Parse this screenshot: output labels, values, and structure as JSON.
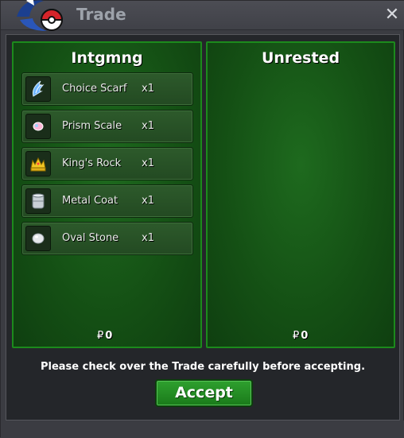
{
  "window": {
    "title": "Trade",
    "close_icon": "close-icon",
    "logo_icon": "pokeball-logo-icon"
  },
  "panels": {
    "left": {
      "player": "Intgmng",
      "money_symbol": "₽",
      "money": "0",
      "items": [
        {
          "name": "Choice Scarf",
          "qty": "x1",
          "icon": "choice-scarf-icon"
        },
        {
          "name": "Prism Scale",
          "qty": "x1",
          "icon": "prism-scale-icon"
        },
        {
          "name": "King's Rock",
          "qty": "x1",
          "icon": "kings-rock-icon"
        },
        {
          "name": "Metal Coat",
          "qty": "x1",
          "icon": "metal-coat-icon"
        },
        {
          "name": "Oval Stone",
          "qty": "x1",
          "icon": "oval-stone-icon"
        }
      ]
    },
    "right": {
      "player": "Unrested",
      "money_symbol": "₽",
      "money": "0",
      "items": []
    }
  },
  "notice": "Please check over the Trade carefully before accepting.",
  "accept_label": "Accept",
  "colors": {
    "panel_green": "#166016",
    "panel_border": "#1c8a1c",
    "accept_green": "#229022",
    "window_bg": "#3b3c42"
  }
}
